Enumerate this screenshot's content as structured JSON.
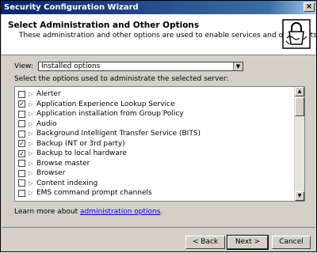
{
  "window": {
    "title": "Security Configuration Wizard",
    "close_glyph": "×"
  },
  "header": {
    "title": "Select Administration and Other Options",
    "description": "These administration and other options are used to enable services and open ports."
  },
  "view": {
    "label": "View:",
    "selected": "Installed options"
  },
  "instruction": "Select the options used to administrate the selected server:",
  "options": [
    {
      "label": "Alerter",
      "checked": false
    },
    {
      "label": "Application Experience Lookup Service",
      "checked": true
    },
    {
      "label": "Application installation from Group Policy",
      "checked": false
    },
    {
      "label": "Audio",
      "checked": false
    },
    {
      "label": "Background Intelligent Transfer Service (BITS)",
      "checked": false
    },
    {
      "label": "Backup (NT or 3rd party)",
      "checked": true
    },
    {
      "label": "Backup to local hardware",
      "checked": true
    },
    {
      "label": "Browse master",
      "checked": false
    },
    {
      "label": "Browser",
      "checked": false
    },
    {
      "label": "Content indexing",
      "checked": false
    },
    {
      "label": "EMS command prompt channels",
      "checked": false
    }
  ],
  "learn_more": {
    "prefix": "Learn more about ",
    "link": "administration options",
    "suffix": "."
  },
  "buttons": {
    "back": "< Back",
    "next": "Next >",
    "cancel": "Cancel"
  },
  "colors": {
    "titlebar": "#0a246a",
    "dialog": "#d4d0c8",
    "link": "#0000cc"
  }
}
